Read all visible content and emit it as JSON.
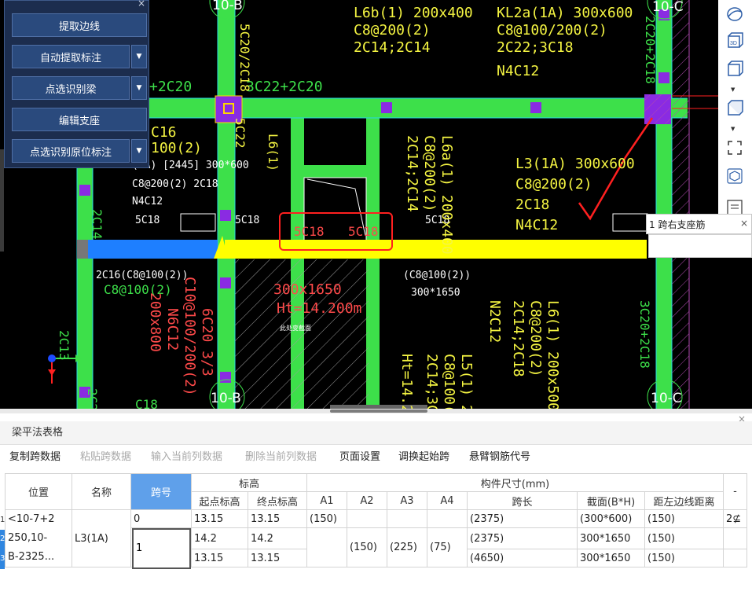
{
  "left_panel": {
    "buttons": [
      "提取边线",
      "自动提取标注",
      "点选识别梁",
      "编辑支座",
      "点选识别原位标注"
    ],
    "close": "×"
  },
  "tooltip": {
    "text": "1 跨右支座筋",
    "close": "×"
  },
  "cad": {
    "axis_labels": [
      "10-B",
      "10-C",
      "10-B",
      "10-C"
    ],
    "texts": [
      "L6b(1) 200x400",
      "C8@200(2)",
      "2C14;2C14",
      "KL2a(1A) 300x600",
      "C8@100/200(2)",
      "2C22;3C18",
      "N4C12",
      "3C22+2C20",
      "+2C20",
      "L3(1A) 300x600",
      "C8@200(2)",
      "2C18",
      "N4C12",
      "(1A) [2445] 300*600",
      "C8@200(2) 2C18",
      "N4C12",
      "5C18",
      "5C18",
      "5C18",
      "5C18",
      "5C18",
      "2C16(C8@100(2))",
      "C8@100(2)",
      "(C8@100(2))",
      "300*1650",
      "300x1650",
      "Ht=14.200m",
      "L6a(1) 200x400",
      "C8@200(2)",
      "2C14;2C14",
      "L6(1) 200x500",
      "C8@200(2)",
      "2C14;2C18",
      "N2C12",
      "L5(1) 2",
      "C8@100(",
      "2C14;3C",
      "Ht=14.2",
      "6C20 3/3",
      "C10@100/200(2)",
      "N6C12",
      "200x800",
      "C16",
      "100(2)",
      "5C20/2C18",
      "5C22",
      "L6(1)",
      "2C14",
      "2C20+2C18",
      "3C20+2C18",
      "2C13",
      "C18",
      "2C20"
    ],
    "marker_text": "此处变截面"
  },
  "bottom_pane": {
    "title": "梁平法表格",
    "close": "×",
    "toolbar": [
      {
        "label": "复制跨数据",
        "enabled": true
      },
      {
        "label": "粘贴跨数据",
        "enabled": false
      },
      {
        "label": "输入当前列数据",
        "enabled": false
      },
      {
        "label": "删除当前列数据",
        "enabled": false
      },
      {
        "label": "页面设置",
        "enabled": true
      },
      {
        "label": "调换起始跨",
        "enabled": true
      },
      {
        "label": "悬臂钢筋代号",
        "enabled": true
      }
    ],
    "table": {
      "headers": {
        "position": "位置",
        "name": "名称",
        "span": "跨号",
        "elevation": "标高",
        "start_elev": "起点标高",
        "end_elev": "终点标高",
        "size_group": "构件尺寸(mm)",
        "a1": "A1",
        "a2": "A2",
        "a3": "A3",
        "a4": "A4",
        "span_len": "跨长",
        "section": "截面(B*H)",
        "left_dist": "距左边线距离",
        "extra": "-"
      },
      "position_value": "<10-7+2 250,10-B-2325...",
      "position_lines": [
        "<10-7+2",
        "250,10-",
        "B-2325..."
      ],
      "name_value": "L3(1A)",
      "rows": [
        {
          "num": "1",
          "span": "0",
          "start": "13.15",
          "end": "13.15",
          "a1": "(150)",
          "a2": "",
          "a3": "",
          "a4": "",
          "span_len": "(2375)",
          "section": "(300*600)",
          "left_dist": "(150)",
          "extra": "2⊈"
        },
        {
          "num": "2",
          "span": "1",
          "start": "14.2",
          "end": "14.2",
          "a1": "",
          "a2": "(150)",
          "a3": "(225)",
          "a4": "(75)",
          "span_len": "(2375)",
          "section": "300*1650",
          "left_dist": "(150)",
          "extra": ""
        },
        {
          "num": "3",
          "span": "",
          "start": "13.15",
          "end": "13.15",
          "a1": "",
          "a2": "",
          "a3": "",
          "a4": "",
          "span_len": "(4650)",
          "section": "300*1650",
          "left_dist": "(150)",
          "extra": ""
        }
      ]
    }
  },
  "colors": {
    "cad_bg": "#000000",
    "beam_green": "#3de04a",
    "beam_cyan": "#28d7e6",
    "highlight_yellow": "#ffff00",
    "selected_blue": "#1e7fff",
    "text_yellow": "#f5f542",
    "text_red": "#ff4a4a",
    "panel_bg": "#1c2d4e",
    "header_sel": "#5fa0ea"
  }
}
